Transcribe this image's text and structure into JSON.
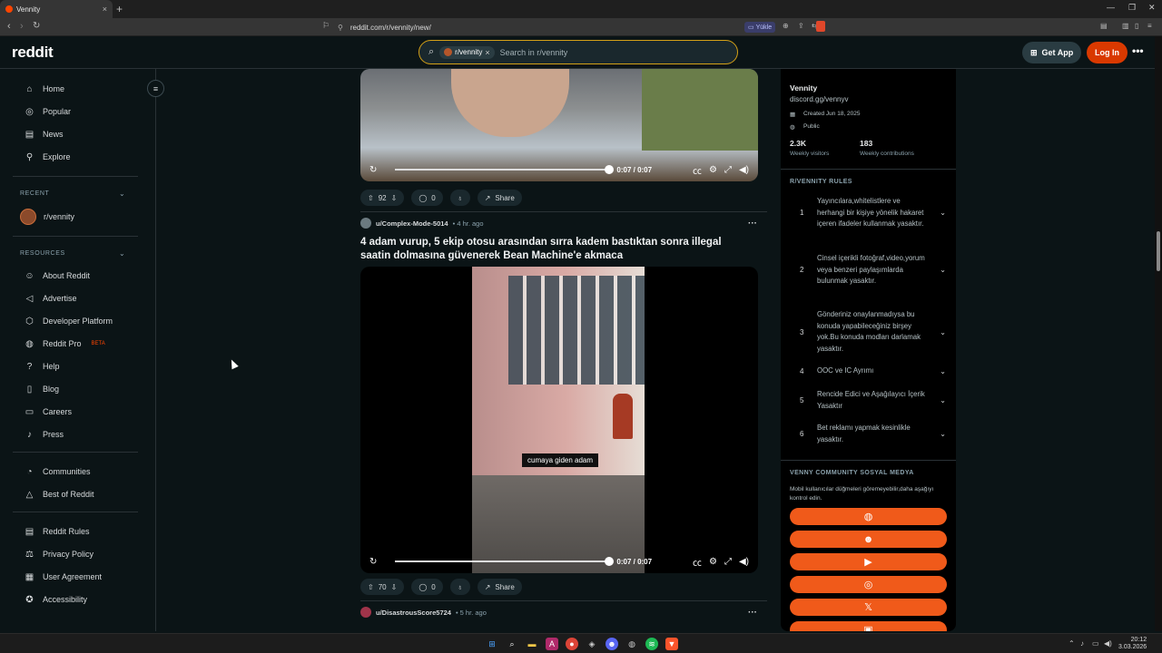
{
  "browser": {
    "tab_title": "Vennity",
    "url": "reddit.com/r/vennity/new/",
    "yukle_label": "Yükle"
  },
  "header": {
    "logo": "reddit",
    "search_chip": "r/vennity",
    "search_placeholder": "Search in r/vennity",
    "get_app": "Get App",
    "login": "Log In"
  },
  "sidebar": {
    "main": [
      {
        "label": "Home",
        "icon": "home-icon"
      },
      {
        "label": "Popular",
        "icon": "popular-icon"
      },
      {
        "label": "News",
        "icon": "news-icon"
      },
      {
        "label": "Explore",
        "icon": "explore-icon"
      }
    ],
    "recent_heading": "RECENT",
    "recent": [
      {
        "label": "r/vennity"
      }
    ],
    "resources_heading": "RESOURCES",
    "resources": [
      {
        "label": "About Reddit"
      },
      {
        "label": "Advertise"
      },
      {
        "label": "Developer Platform"
      },
      {
        "label": "Reddit Pro",
        "badge": "BETA"
      },
      {
        "label": "Help"
      },
      {
        "label": "Blog"
      },
      {
        "label": "Careers"
      },
      {
        "label": "Press"
      }
    ],
    "more": [
      {
        "label": "Communities"
      },
      {
        "label": "Best of Reddit"
      }
    ],
    "legal": [
      {
        "label": "Reddit Rules"
      },
      {
        "label": "Privacy Policy"
      },
      {
        "label": "User Agreement"
      },
      {
        "label": "Accessibility"
      }
    ]
  },
  "posts": [
    {
      "video_time": "0:07 / 0:07",
      "votes": "92",
      "comments": "0",
      "share": "Share"
    },
    {
      "author": "u/Complex-Mode-5014",
      "age": "• 4 hr. ago",
      "title": "4 adam vurup, 5 ekip otosu arasından sırra kadem bastıktan sonra illegal saatin dolmasına güvenerek Bean Machine'e akmaca",
      "caption": "cumaya giden adam",
      "video_time": "0:07 / 0:07",
      "votes": "70",
      "comments": "0",
      "share": "Share"
    },
    {
      "author": "u/DisastrousScore5724",
      "age": "• 5 hr. ago"
    }
  ],
  "community": {
    "name": "Vennity",
    "link": "discord.gg/vennyv",
    "created": "Created Jun 18, 2025",
    "visibility": "Public",
    "visitors_value": "2.3K",
    "visitors_label": "Weekly visitors",
    "contrib_value": "183",
    "contrib_label": "Weekly contributions",
    "rules_heading": "R/VENNITY RULES",
    "rules": [
      {
        "num": "1",
        "text": "Yayıncılara,whitelistlere ve herhangi bir kişiye yönelik hakaret içeren ifadeler kullanmak yasaktır."
      },
      {
        "num": "2",
        "text": "Cinsel içerikli fotoğraf,video,yorum veya benzeri paylaşımlarda bulunmak yasaktır."
      },
      {
        "num": "3",
        "text": "Gönderiniz onaylanmadıysa bu konuda yapabileceğiniz birşey yok.Bu konuda modları darlamak yasaktır."
      },
      {
        "num": "4",
        "text": "OOC ve IC Ayrımı"
      },
      {
        "num": "5",
        "text": "Rencide Edici ve Aşağılayıcı İçerik Yasaktır"
      },
      {
        "num": "6",
        "text": "Bet reklamı yapmak kesinlikle yasaktır."
      }
    ],
    "social_heading": "VENNY COMMUNITY SOSYAL MEDYA",
    "social_note": "Mobil kullanıcılar düğmeleri göremeyebilir,daha aşağıyı kontrol edin.",
    "social_buttons": [
      "globe-icon",
      "discord-icon",
      "youtube-icon",
      "instagram-icon",
      "x-icon"
    ]
  },
  "taskbar": {
    "time": "20:12",
    "date": "3.03.2026"
  },
  "colors": {
    "accent": "#d93900",
    "social": "#f05a1a",
    "bg": "#0b1416"
  }
}
